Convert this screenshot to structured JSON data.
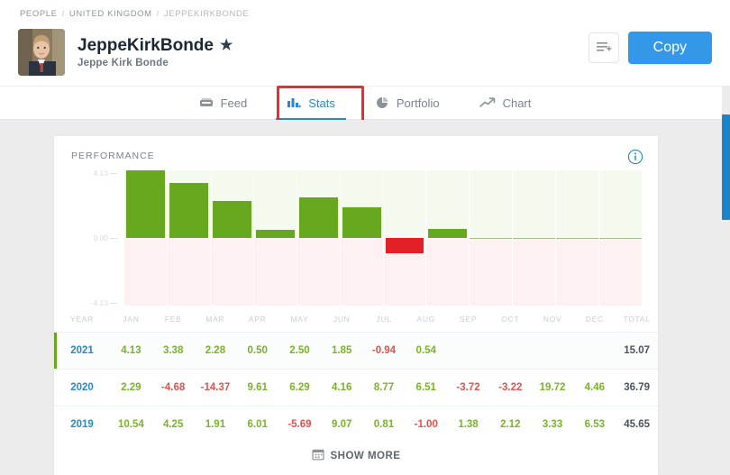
{
  "breadcrumb": {
    "items": [
      "PEOPLE",
      "UNITED KINGDOM",
      "JEPPEKIRKBONDE"
    ],
    "separator": "/"
  },
  "profile": {
    "avatar_alt": "avatar",
    "display_name": "JeppeKirkBonde",
    "star_icon": "star-icon",
    "real_name": "Jeppe Kirk Bonde"
  },
  "header_actions": {
    "list_icon": "add-to-list-icon",
    "copy_label": "Copy"
  },
  "tabs": [
    {
      "label": "Feed",
      "icon": "feed-icon",
      "active": false
    },
    {
      "label": "Stats",
      "icon": "bar-chart-icon",
      "active": true
    },
    {
      "label": "Portfolio",
      "icon": "pie-chart-icon",
      "active": false
    },
    {
      "label": "Chart",
      "icon": "line-chart-icon",
      "active": false
    }
  ],
  "card": {
    "title": "PERFORMANCE",
    "info_icon": "info-icon",
    "show_more_label": "SHOW MORE",
    "show_more_icon": "calendar-icon",
    "accent_color": "#67a81e"
  },
  "chart_data": {
    "type": "bar",
    "title": "PERFORMANCE",
    "xlabel": "",
    "ylabel": "",
    "grid": true,
    "legend": null,
    "ylim": [
      -4.13,
      4.13
    ],
    "ytick_labels": [
      "4.13",
      "0.00",
      "-4.13"
    ],
    "ytick_values": [
      4.13,
      0.0,
      -4.13
    ],
    "categories": [
      "JAN",
      "FEB",
      "MAR",
      "APR",
      "MAY",
      "JUN",
      "JUL",
      "AUG",
      "SEP",
      "OCT",
      "NOV",
      "DEC"
    ],
    "values": [
      4.13,
      3.38,
      2.28,
      0.5,
      2.5,
      1.85,
      -0.94,
      0.54,
      null,
      null,
      null,
      null
    ],
    "positive_color": "#67a81e",
    "negative_color": "#e01f26",
    "positive_band_color": "#f4faee",
    "negative_band_color": "#fdf1f1"
  },
  "table": {
    "headers": [
      "YEAR",
      "JAN",
      "FEB",
      "MAR",
      "APR",
      "MAY",
      "JUN",
      "JUL",
      "AUG",
      "SEP",
      "OCT",
      "NOV",
      "DEC",
      "TOTAL"
    ],
    "rows": [
      {
        "year": "2021",
        "highlighted": true,
        "cells": [
          "4.13",
          "3.38",
          "2.28",
          "0.50",
          "2.50",
          "1.85",
          "-0.94",
          "0.54",
          "",
          "",
          "",
          ""
        ],
        "total": "15.07"
      },
      {
        "year": "2020",
        "highlighted": false,
        "cells": [
          "2.29",
          "-4.68",
          "-14.37",
          "9.61",
          "6.29",
          "4.16",
          "8.77",
          "6.51",
          "-3.72",
          "-3.22",
          "19.72",
          "4.46"
        ],
        "total": "36.79"
      },
      {
        "year": "2019",
        "highlighted": false,
        "cells": [
          "10.54",
          "4.25",
          "1.91",
          "6.01",
          "-5.69",
          "9.07",
          "0.81",
          "-1.00",
          "1.38",
          "2.12",
          "3.33",
          "6.53"
        ],
        "total": "45.65"
      }
    ]
  },
  "scrollbar": {
    "name": "page-scrollbar"
  }
}
